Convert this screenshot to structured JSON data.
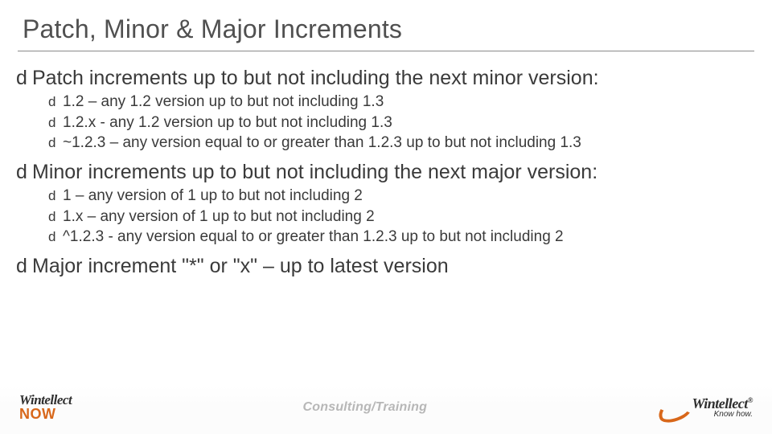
{
  "title": "Patch, Minor & Major Increments",
  "bullet_glyph": "d",
  "sections": [
    {
      "heading": "Patch increments up to but not including the next minor version:",
      "items": [
        "1.2 – any 1.2 version up to but not including 1.3",
        "1.2.x - any 1.2 version up to but not including 1.3",
        "~1.2.3 – any version equal to or greater than 1.2.3 up to but not including 1.3"
      ]
    },
    {
      "heading": "Minor increments up to but not including the next major version:",
      "items": [
        "1 – any version of 1 up to but not including 2",
        "1.x – any version of 1 up to but not including 2",
        "^1.2.3 - any version equal to or greater than 1.2.3 up to but not including 2"
      ]
    },
    {
      "heading": "Major increment \"*\" or \"x\" – up to latest version",
      "items": []
    }
  ],
  "footer": {
    "left_line1": "Wintellect",
    "left_line2_a": "N",
    "left_line2_b": "O",
    "left_line2_c": "W",
    "center": "Consulting/Training",
    "right_line1": "Wintellect",
    "right_sup": "®",
    "right_line2": "Know how."
  }
}
